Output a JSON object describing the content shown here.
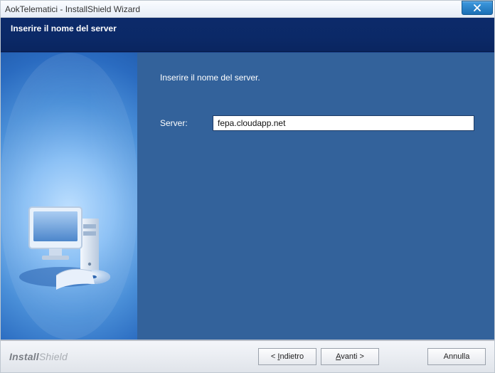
{
  "window": {
    "title": "AokTelematici - InstallShield Wizard"
  },
  "header": {
    "title": "Inserire il nome del server"
  },
  "content": {
    "instruction": "Inserire il nome del server.",
    "server_label": "Server:",
    "server_value": "fepa.cloudapp.net"
  },
  "footer": {
    "brand_strong": "Install",
    "brand_light": "Shield",
    "back_prefix": "< ",
    "back_key": "I",
    "back_rest": "ndietro",
    "next_key": "A",
    "next_rest": "vanti >",
    "cancel": "Annulla"
  }
}
